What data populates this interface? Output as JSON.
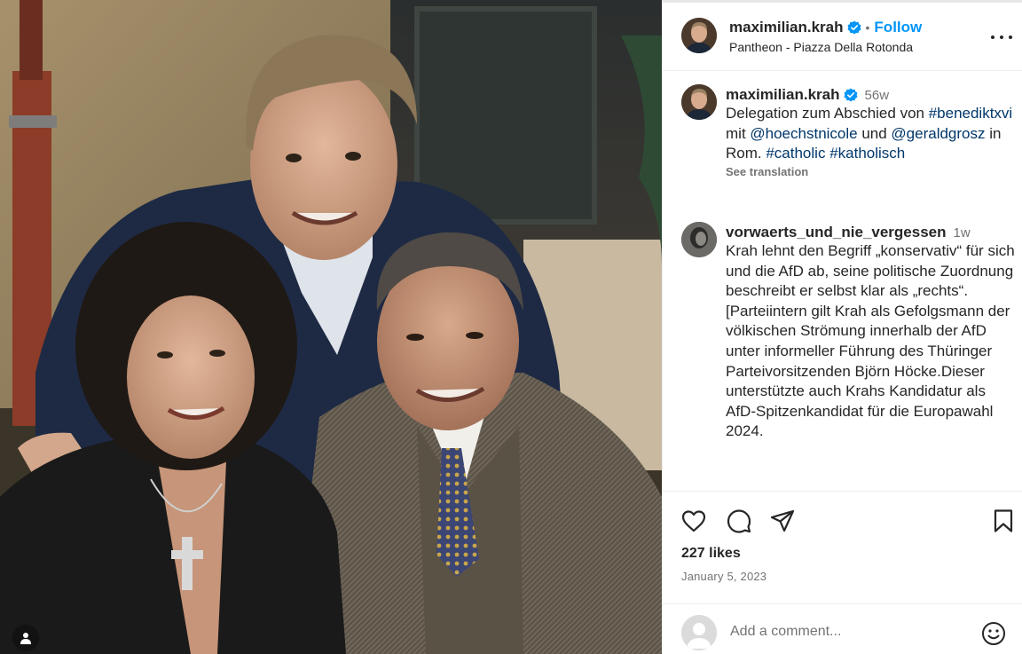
{
  "photo": {
    "alt": "Three people posing together",
    "user_tag_icon": "user-tag-icon"
  },
  "header": {
    "username": "maximilian.krah",
    "verified_icon": "verified-badge-icon",
    "separator": "•",
    "follow_label": "Follow",
    "location": "Pantheon - Piazza Della Rotonda",
    "more_icon": "more-options-icon"
  },
  "caption": {
    "username": "maximilian.krah",
    "time": "56w",
    "parts": {
      "t1": "Delegation zum Abschied von ",
      "tag1": "#benediktxvi",
      "t2": " mit ",
      "tag2": "@hoechstnicole",
      "t3": " und ",
      "tag3": "@geraldgrosz",
      "t4": " in Rom. ",
      "tag4": "#catholic",
      "t5": " ",
      "tag5": "#katholisch"
    },
    "see_translation": "See translation"
  },
  "comment": {
    "username": "vorwaerts_und_nie_vergessen",
    "time": "1w",
    "text": "Krah lehnt den Begriff „konservativ“ für sich und die AfD ab, seine politische Zuordnung beschreibt er selbst klar als „rechts“.[Parteiintern gilt Krah als Gefolgsmann der völkischen Strömung innerhalb der AfD unter informeller Führung des Thüringer Parteivorsitzenden Björn Höcke.Dieser unterstützte auch Krahs Kandidatur als AfD-Spitzenkandidat für die Europawahl 2024."
  },
  "actions": {
    "like_icon": "heart-icon",
    "comment_icon": "comment-icon",
    "share_icon": "share-icon",
    "save_icon": "bookmark-icon",
    "likes": "227 likes",
    "date": "January 5, 2023"
  },
  "add_comment": {
    "placeholder": "Add a comment...",
    "emoji_icon": "emoji-icon"
  },
  "colors": {
    "accent": "#0095f6",
    "link": "#00376b",
    "muted": "#737373",
    "text": "#262626",
    "border": "#efefef"
  }
}
